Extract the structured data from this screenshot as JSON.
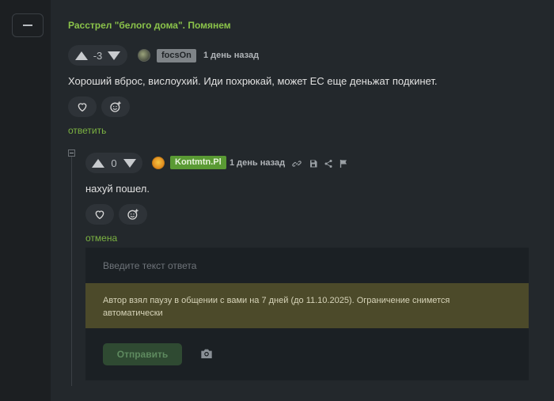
{
  "story": {
    "title": "Расстрел \"белого дома\". Помянем"
  },
  "comment": {
    "rating": "-3",
    "username": "focsOn",
    "timestamp": "1 день назад",
    "text": "Хороший вброс, вислоухий. Иди похрюкай, может ЕС еще деньжат подкинет.",
    "reply_label": "ответить"
  },
  "reply": {
    "rating": "0",
    "username": "Kontmtn.Pl",
    "timestamp": "1 день назад",
    "text": "нахуй пошел.",
    "cancel_label": "отмена"
  },
  "reply_form": {
    "placeholder": "Введите текст ответа",
    "notice": "Автор взял паузу в общении с вами на 7 дней (до 11.10.2025). Ограничение снимется автоматически",
    "send_label": "Отправить"
  },
  "colors": {
    "accent": "#8bc34a",
    "notice_bg": "#4c4a2a",
    "user_badge_green": "#5a9a34"
  },
  "icons": [
    "collapse-icon",
    "upvote-icon",
    "downvote-icon",
    "heart-icon",
    "emoji-icon",
    "link-icon",
    "save-icon",
    "share-icon",
    "flag-icon",
    "camera-icon"
  ]
}
